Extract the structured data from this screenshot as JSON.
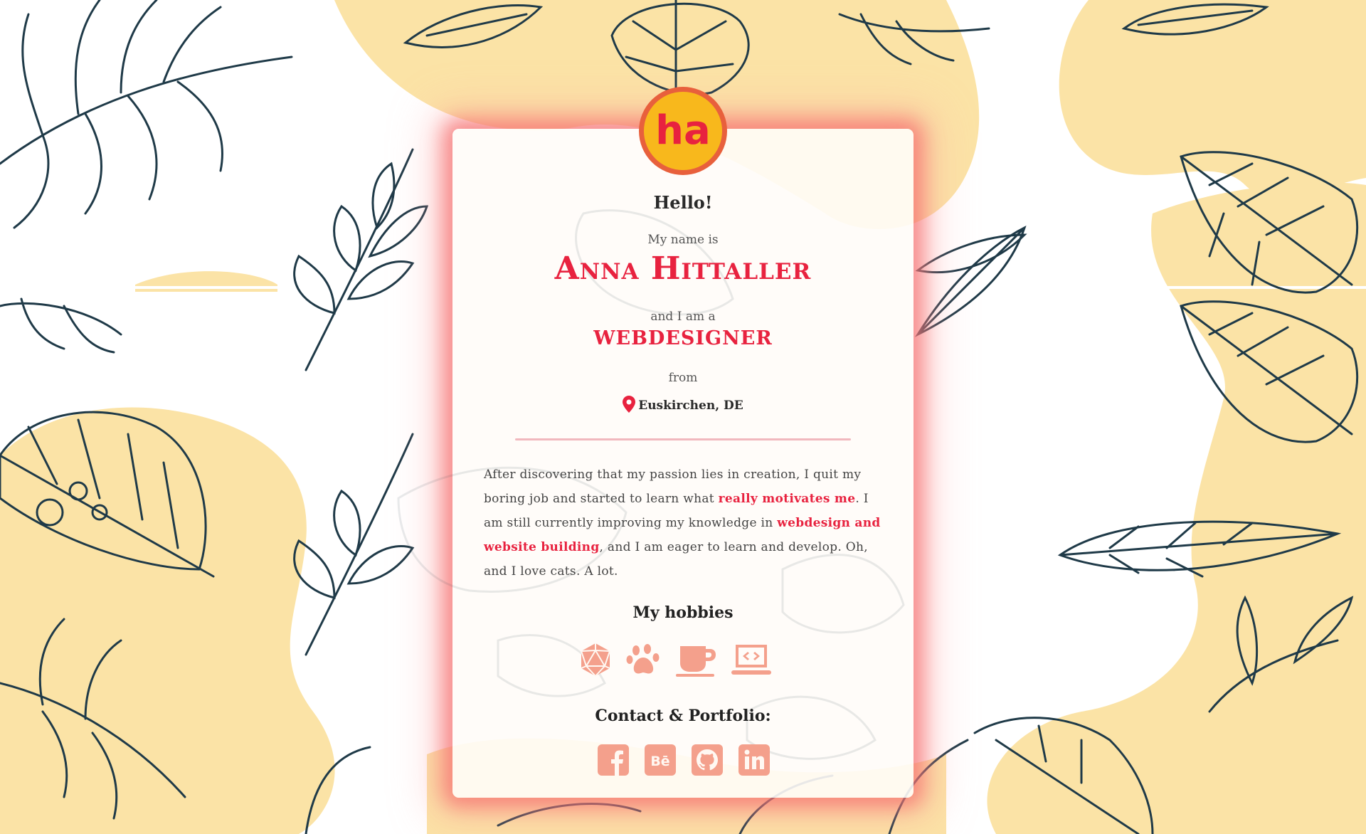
{
  "profile": {
    "greeting": "Hello!",
    "name_intro": "My name is",
    "name": "Anna Hittaller",
    "role_intro": "and I am a",
    "role": "WEBDESIGNER",
    "location_intro": "from",
    "location": "Euskirchen, DE",
    "logo_text": "ha"
  },
  "about": {
    "part1": "After discovering that my passion lies in creation, I quit my boring job and started to learn what ",
    "highlight1": "really motivates me",
    "part2": ". I am still currently improving my knowledge in ",
    "highlight2": "webdesign and website building",
    "part3": ", and I am eager to learn and develop. Oh, and I love cats. A lot."
  },
  "hobbies": {
    "title": "My hobbies",
    "items": [
      "d20-dice-icon",
      "paw-icon",
      "coffee-cup-icon",
      "laptop-code-icon"
    ]
  },
  "contact": {
    "title": "Contact & Portfolio:",
    "items": [
      "facebook-icon",
      "behance-icon",
      "github-icon",
      "linkedin-icon"
    ]
  },
  "colors": {
    "accent": "#e8223f",
    "icon": "#f4a08c",
    "blob": "#fbe3a6",
    "leaf": "#1f3a48",
    "glow": "#f46e6e"
  }
}
